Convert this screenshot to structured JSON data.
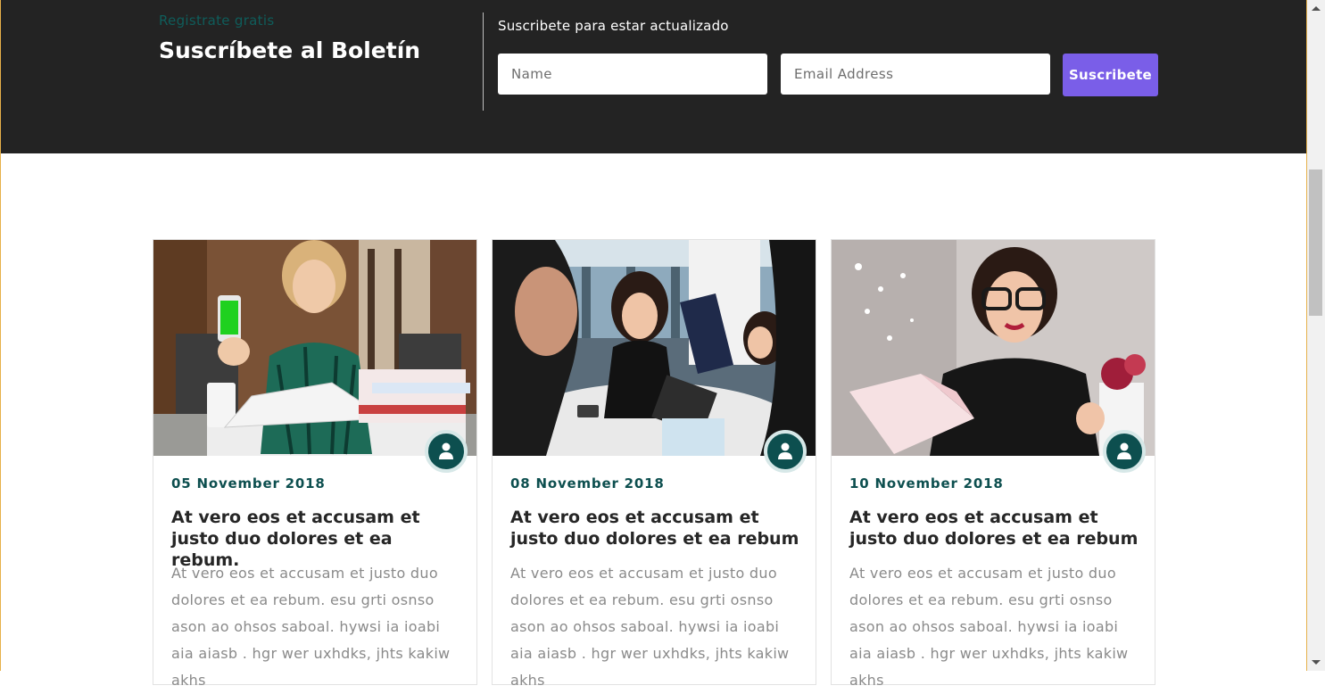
{
  "newsletter": {
    "kicker": "Registrate gratis",
    "title": "Suscríbete al Boletín",
    "subtitle": "Suscribete para estar actualizado",
    "name_placeholder": "Name",
    "email_placeholder": "Email Address",
    "button_label": "Suscribete",
    "button_color": "#7a5ee8"
  },
  "posts": [
    {
      "date": "05 November 2018",
      "title": "At vero eos et accusam et justo duo dolores et ea rebum.",
      "excerpt": "At vero eos et accusam et justo duo dolores et ea rebum. esu grti osnso ason ao ohsos saboal. hywsi ia ioabi aia aiasb . hgr wer uxhdks, jhts kakiw akhs",
      "image_icon": "student-with-phone-photo",
      "author_icon": "user-icon"
    },
    {
      "date": "08 November 2018",
      "title": "At vero eos et accusam et justo duo dolores et ea rebum",
      "excerpt": "At vero eos et accusam et justo duo dolores et ea rebum. esu grti osnso ason ao ohsos saboal. hywsi ia ioabi aia aiasb . hgr wer uxhdks, jhts kakiw akhs",
      "image_icon": "group-meeting-photo",
      "author_icon": "user-icon"
    },
    {
      "date": "10 November 2018",
      "title": "At vero eos et accusam et justo duo dolores et ea rebum",
      "excerpt": "At vero eos et accusam et justo duo dolores et ea rebum. esu grti osnso ason ao ohsos saboal. hywsi ia ioabi aia aiasb . hgr wer uxhdks, jhts kakiw akhs",
      "image_icon": "woman-reading-book-photo",
      "author_icon": "user-icon"
    }
  ],
  "colors": {
    "accent_teal": "#0d4f4f",
    "dark_bg": "#232323"
  }
}
